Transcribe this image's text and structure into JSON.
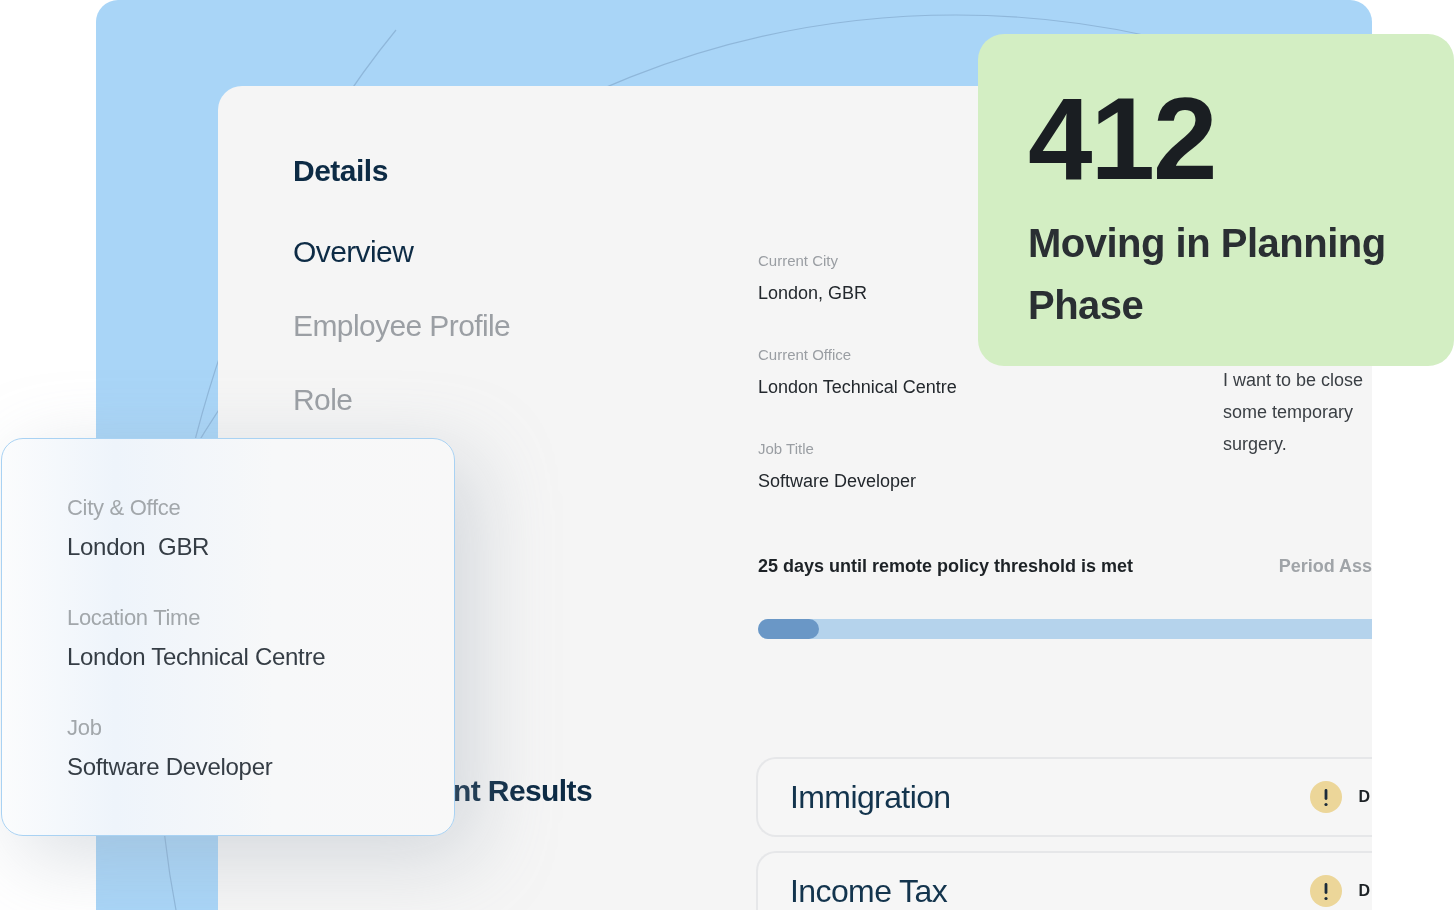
{
  "details_panel": {
    "title": "Details",
    "nav": [
      {
        "label": "Overview",
        "selected": true
      },
      {
        "label": "Employee Profile",
        "selected": false
      },
      {
        "label": "Role",
        "selected": false
      }
    ],
    "fields": [
      {
        "label": "Current City",
        "value": "London, GBR"
      },
      {
        "label": "Current Office",
        "value": "London Technical Centre"
      },
      {
        "label": "Job Title",
        "value": "Software Developer"
      }
    ],
    "note_lines": [
      "I want to be close",
      "some temporary",
      "surgery."
    ],
    "policy": {
      "message": "25 days until remote policy threshold is met",
      "period_label": "Period Ass",
      "level": 0.1
    },
    "results_heading": "nt Results",
    "results": [
      {
        "title": "Immigration",
        "kind": "warning",
        "status_text": "D"
      },
      {
        "title": "Income Tax",
        "kind": "warning",
        "status_text": "D"
      }
    ]
  },
  "location_card": {
    "fields": [
      {
        "label": "City & Offce",
        "value": "London  GBR"
      },
      {
        "label": "Location Time",
        "value": "London Technical Centre"
      },
      {
        "label": "Job",
        "value": "Software Developer"
      }
    ]
  },
  "stat_card": {
    "value": "412",
    "caption": "Moving in Planning Phase"
  }
}
